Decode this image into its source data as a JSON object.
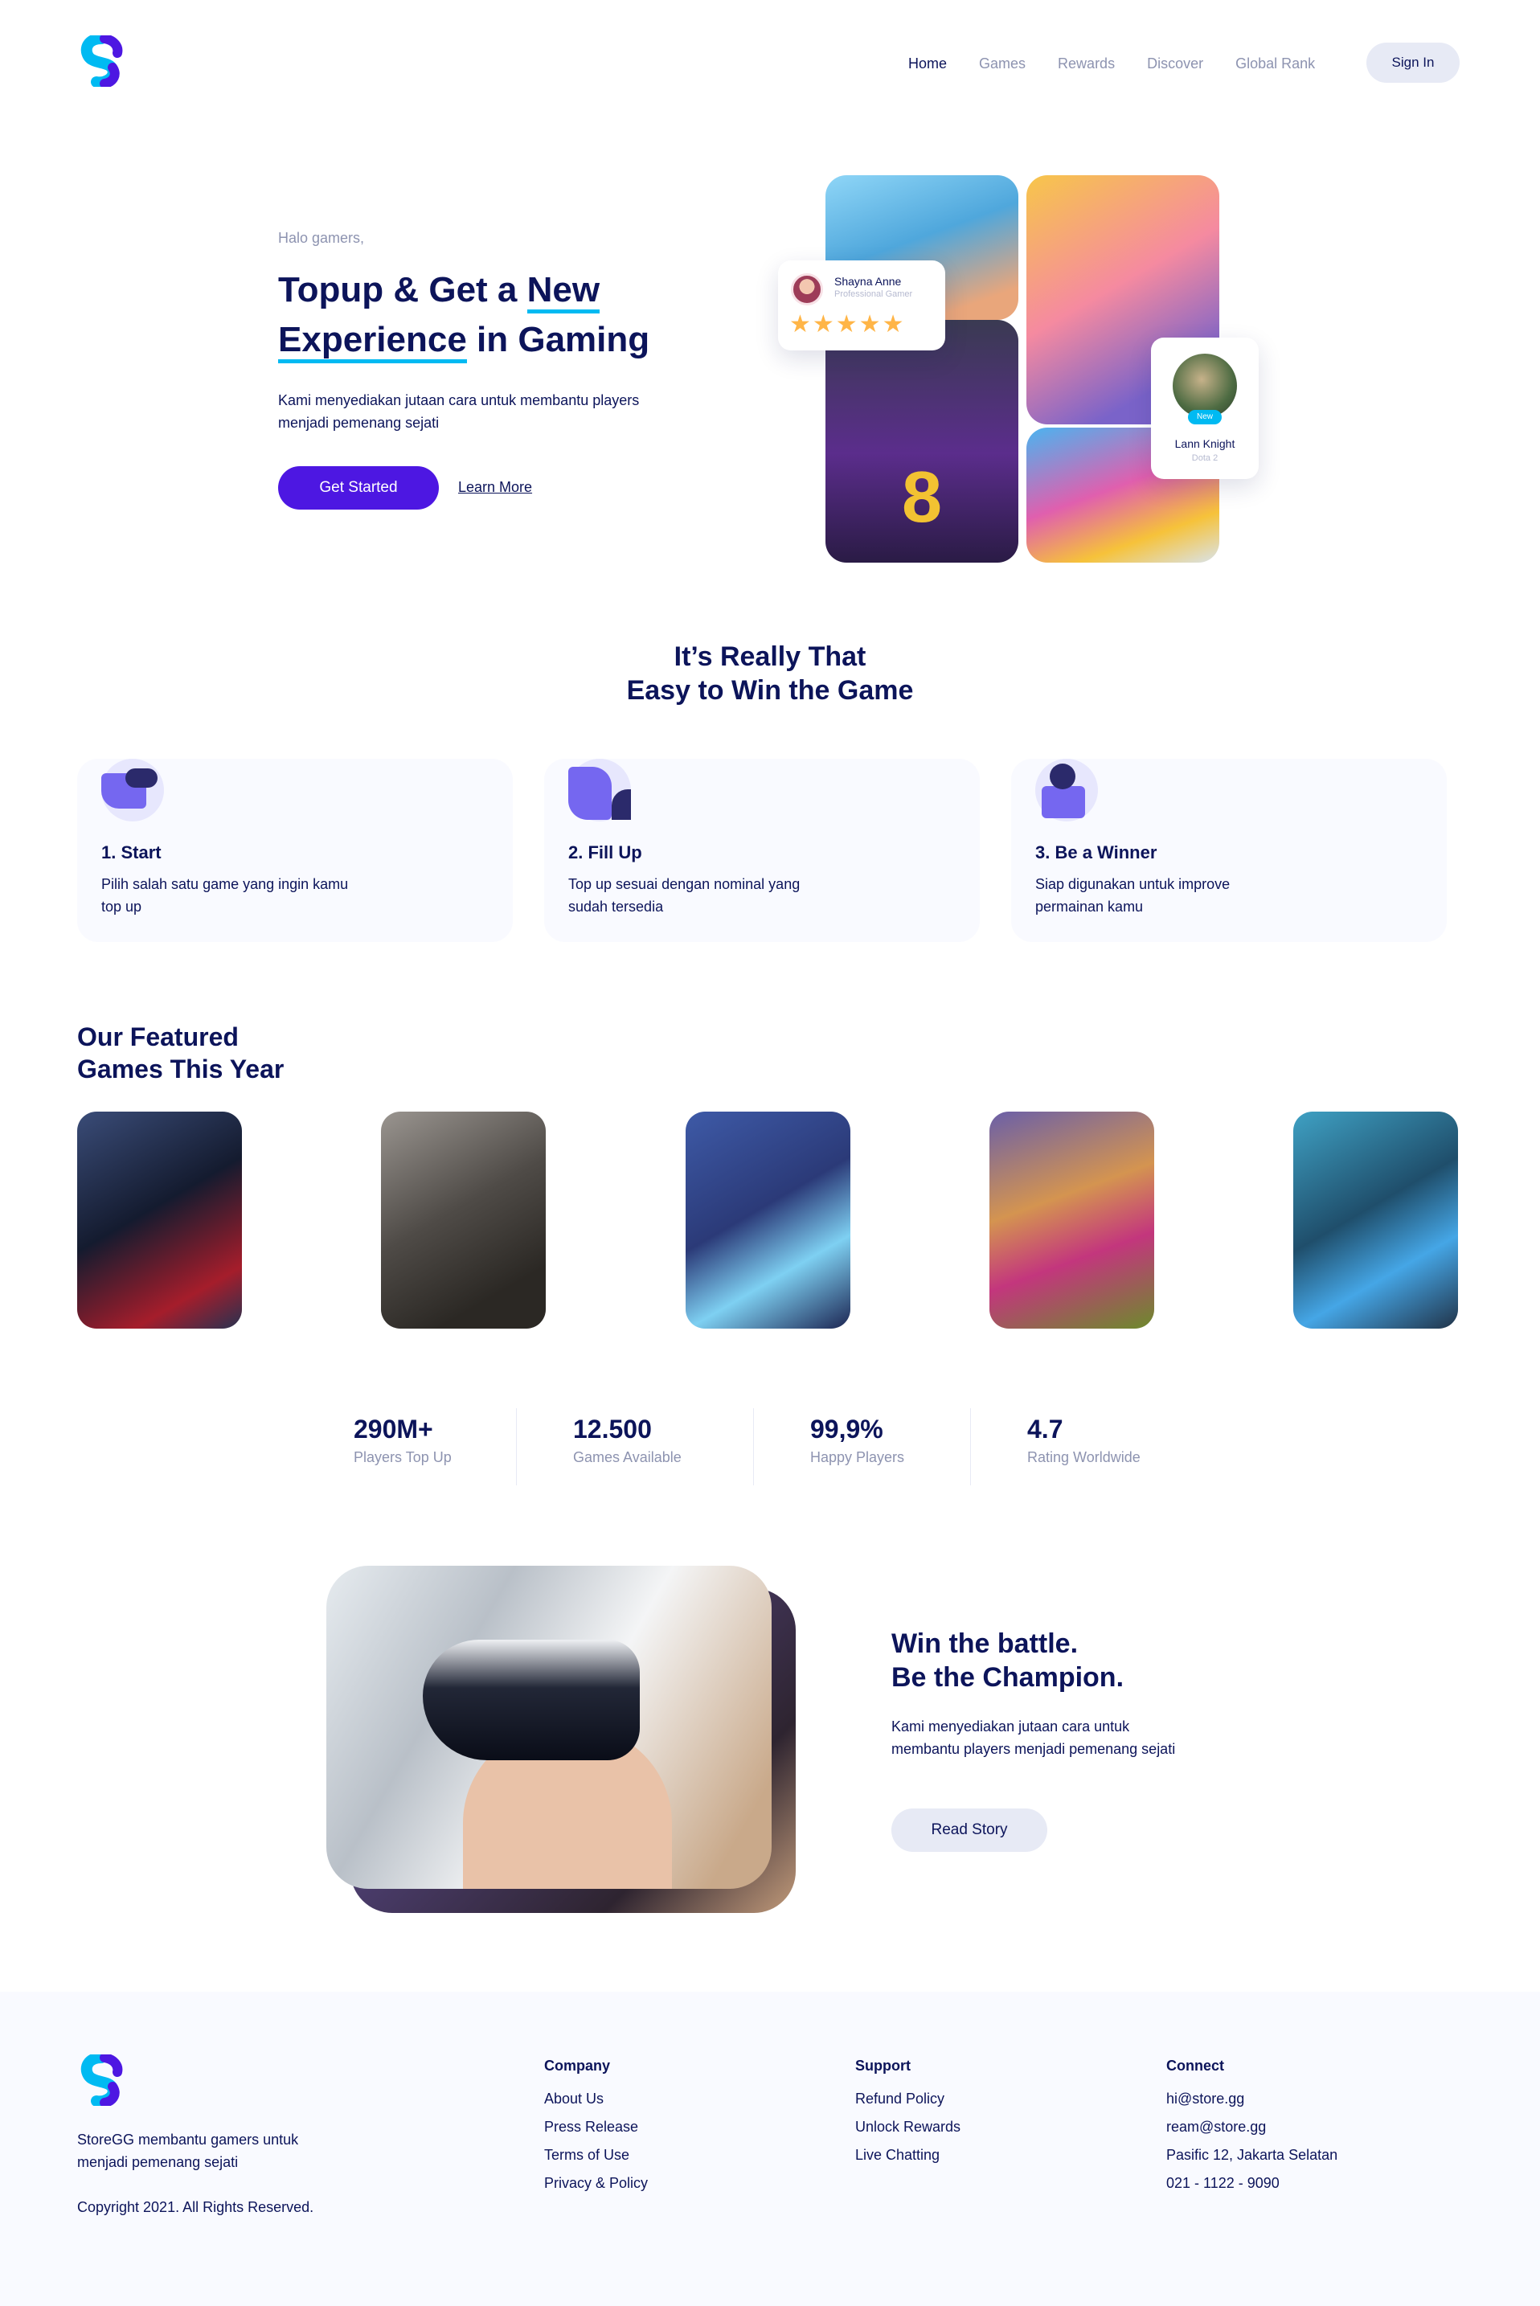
{
  "header": {
    "nav": [
      "Home",
      "Games",
      "Rewards",
      "Discover",
      "Global Rank"
    ],
    "sign_in": "Sign In"
  },
  "hero": {
    "greeting": "Halo gamers,",
    "title_part1": "Topup & Get a ",
    "title_new": "New",
    "title_experience": "Experience",
    "title_part2": " in Gaming",
    "description": "Kami menyediakan jutaan cara untuk membantu players menjadi pemenang sejati",
    "cta_primary": "Get Started",
    "cta_secondary": "Learn More",
    "card1": {
      "name": "Shayna Anne",
      "role": "Professional Gamer",
      "stars": "★★★★★",
      "rating": 5
    },
    "card2": {
      "name": "Lann Knight",
      "role": "Dota 2",
      "badge": "New"
    }
  },
  "steps": {
    "title_line1": "It’s Really That",
    "title_line2": "Easy to Win the Game",
    "items": [
      {
        "title": "1. Start",
        "desc": "Pilih salah satu game yang ingin kamu top up"
      },
      {
        "title": "2. Fill Up",
        "desc": "Top up sesuai dengan nominal yang sudah tersedia"
      },
      {
        "title": "3. Be a Winner",
        "desc": "Siap digunakan untuk improve permainan kamu"
      }
    ]
  },
  "featured": {
    "title_line1": "Our Featured",
    "title_line2": "Games This Year",
    "games": [
      "mass-effect",
      "call-of-duty",
      "mobile-legends",
      "clash-of-clans",
      "dota-hero"
    ]
  },
  "stats": [
    {
      "value": "290M+",
      "label": "Players Top Up"
    },
    {
      "value": "12.500",
      "label": "Games Available"
    },
    {
      "value": "99,9%",
      "label": "Happy Players"
    },
    {
      "value": "4.7",
      "label": "Rating Worldwide"
    }
  ],
  "story": {
    "title_line1": "Win the battle.",
    "title_line2": "Be the Champion.",
    "description": "Kami menyediakan jutaan cara untuk membantu players menjadi pemenang sejati",
    "cta": "Read Story"
  },
  "footer": {
    "about": "StoreGG membantu gamers untuk menjadi pemenang sejati",
    "copyright": "Copyright 2021. All Rights Reserved.",
    "columns": [
      {
        "heading": "Company",
        "items": [
          "About Us",
          "Press Release",
          "Terms of Use",
          "Privacy & Policy"
        ]
      },
      {
        "heading": "Support",
        "items": [
          "Refund Policy",
          "Unlock Rewards",
          "Live Chatting"
        ]
      },
      {
        "heading": "Connect",
        "items": [
          "hi@store.gg",
          "ream@store.gg",
          "Pasific 12, Jakarta Selatan",
          "021 - 1122 - 9090"
        ]
      }
    ]
  },
  "colors": {
    "primary": "#4d17e2",
    "navy": "#0c145a",
    "accent": "#00baf2",
    "muted": "#8d93b0",
    "star": "#ffb547"
  }
}
